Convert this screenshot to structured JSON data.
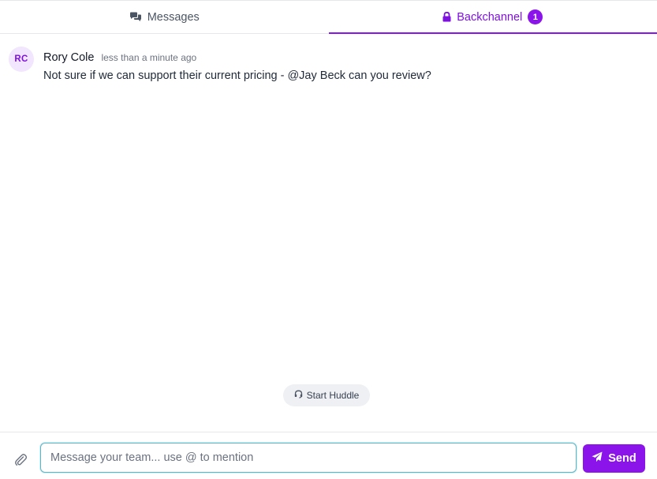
{
  "tabs": {
    "messages": {
      "label": "Messages",
      "icon": "comments-icon"
    },
    "backchannel": {
      "label": "Backchannel",
      "icon": "lock-icon",
      "badge": "1",
      "active": true
    }
  },
  "colors": {
    "accent": "#8b14ea",
    "accent_text": "#7e10e0",
    "avatar_bg": "#f1e6fd"
  },
  "message": {
    "avatar_initials": "RC",
    "author": "Rory Cole",
    "time": "less than a minute ago",
    "text": "Not sure if we can support their current pricing - @Jay Beck can you review?"
  },
  "huddle": {
    "label": "Start Huddle",
    "icon": "headset-icon"
  },
  "composer": {
    "attach_icon": "paperclip-icon",
    "placeholder": "Message your team... use @ to mention",
    "value": "",
    "send_label": "Send",
    "send_icon": "paper-plane-icon"
  }
}
